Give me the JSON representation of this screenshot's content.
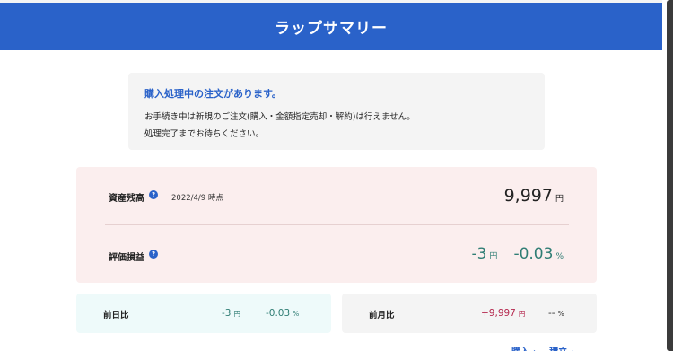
{
  "header": {
    "title": "ラップサマリー"
  },
  "notice": {
    "title": "購入処理中の注文があります。",
    "line1": "お手続き中は新規のご注文(購入・金額指定売却・解約)は行えません。",
    "line2": "処理完了までお待ちください。"
  },
  "balance": {
    "label": "資産残高",
    "help": "?",
    "timestamp": "2022/4/9 時点",
    "value": "9,997",
    "unit": "円"
  },
  "profit_loss": {
    "label": "評価損益",
    "help": "?",
    "amount": "-3",
    "amount_unit": "円",
    "percent": "-0.03",
    "percent_unit": "%"
  },
  "day_change": {
    "label": "前日比",
    "amount": "-3",
    "amount_unit": "円",
    "percent": "-0.03",
    "percent_unit": "%"
  },
  "month_change": {
    "label": "前月比",
    "amount": "+9,997",
    "amount_unit": "円",
    "percent": "--",
    "percent_unit": "%"
  },
  "links": {
    "buy": "購入",
    "accumulate": "積立"
  },
  "colors": {
    "brand_blue": "#2a62c9",
    "teal_value": "#2f7d74",
    "pink_value": "#b5284e",
    "balance_card_bg": "#fbeeee",
    "day_card_bg": "#eefafa",
    "notice_bg": "#f4f4f4"
  },
  "icons": {
    "help": "help-icon",
    "chevron": "chevron-right-icon"
  }
}
